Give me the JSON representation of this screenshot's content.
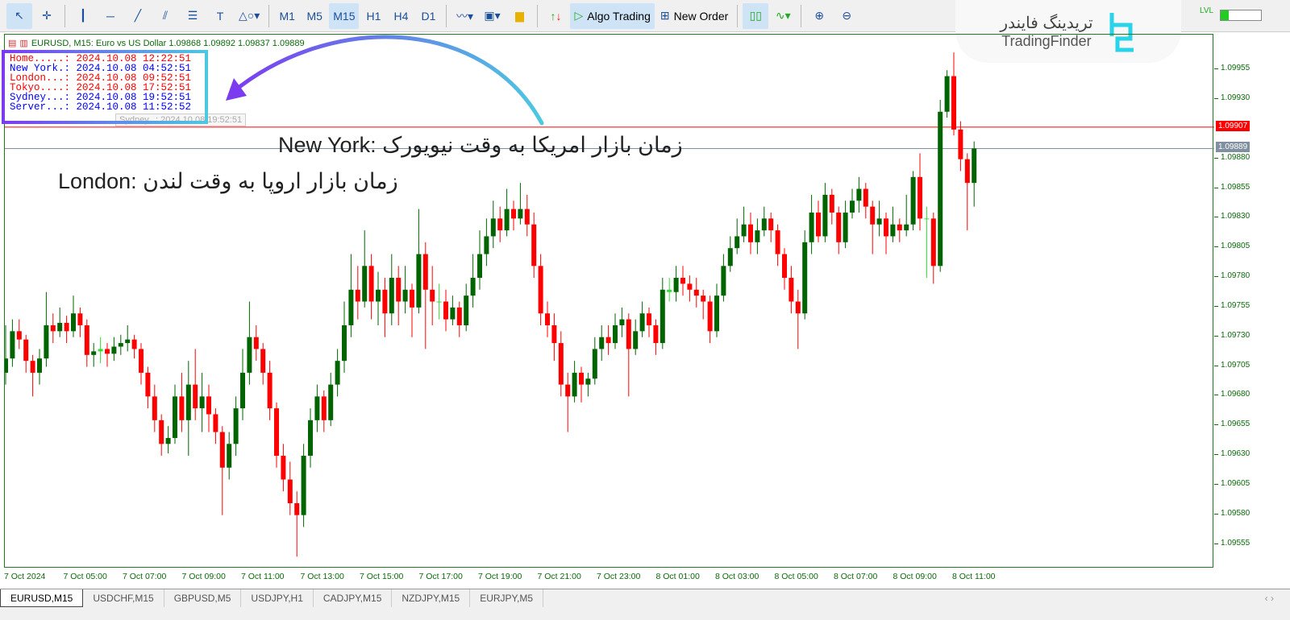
{
  "toolbar": {
    "timeframes": [
      "M1",
      "M5",
      "M15",
      "H1",
      "H4",
      "D1"
    ],
    "active_timeframe": "M15",
    "algo_trading": "Algo Trading",
    "new_order": "New Order"
  },
  "logo": {
    "fa": "تریدینگ فایندر",
    "en": "TradingFinder"
  },
  "chart_header": "EURUSD, M15:  Euro vs US Dollar  1.09868 1.09892 1.09837 1.09889",
  "clock": [
    {
      "label": "Home.....:",
      "value": "2024.10.08 12:22:51",
      "color": "#ff0000"
    },
    {
      "label": "New York.:",
      "value": "2024.10.08 04:52:51",
      "color": "#0000ff"
    },
    {
      "label": "London...:",
      "value": "2024.10.08 09:52:51",
      "color": "#ff0000"
    },
    {
      "label": "Tokyo....:",
      "value": "2024.10.08 17:52:51",
      "color": "#ff0000"
    },
    {
      "label": "Sydney...:",
      "value": "2024.10.08 19:52:51",
      "color": "#0000ff"
    },
    {
      "label": "Server...:",
      "value": "2024.10.08 11:52:52",
      "color": "#0000ff"
    }
  ],
  "tooltip": "Sydney...: 2024.10.08 19:52:51",
  "annotations": {
    "newyork": "New York: زمان بازار امریکا به وقت نیویورک",
    "london": "London: زمان بازار اروپا به وقت لندن"
  },
  "tabs": [
    "EURUSD,M15",
    "USDCHF,M15",
    "GBPUSD,M5",
    "USDJPY,H1",
    "CADJPY,M15",
    "NZDJPY,M15",
    "EURJPY,M5"
  ],
  "active_tab": "EURUSD,M15",
  "chart_data": {
    "type": "candlestick",
    "symbol": "EURUSD",
    "timeframe": "M15",
    "ylim": [
      1.09535,
      1.09985
    ],
    "price_ticks": [
      "1.09955",
      "1.09930",
      "1.09880",
      "1.09855",
      "1.09830",
      "1.09805",
      "1.09780",
      "1.09755",
      "1.09730",
      "1.09705",
      "1.09680",
      "1.09655",
      "1.09630",
      "1.09605",
      "1.09580",
      "1.09555"
    ],
    "time_ticks": [
      "7 Oct 2024",
      "7 Oct 05:00",
      "7 Oct 07:00",
      "7 Oct 09:00",
      "7 Oct 11:00",
      "7 Oct 13:00",
      "7 Oct 15:00",
      "7 Oct 17:00",
      "7 Oct 19:00",
      "7 Oct 21:00",
      "7 Oct 23:00",
      "8 Oct 01:00",
      "8 Oct 03:00",
      "8 Oct 05:00",
      "8 Oct 07:00",
      "8 Oct 09:00",
      "8 Oct 11:00"
    ],
    "lines": [
      {
        "price": "1.09907",
        "color": "#ff0000"
      },
      {
        "price": "1.09889",
        "color": "#8090a0"
      }
    ],
    "colors": {
      "bull": "#006400",
      "bear": "#ff0000",
      "doji": "#33dd33"
    },
    "ohlc": [
      [
        1.097,
        1.0974,
        1.0969,
        1.09712
      ],
      [
        1.09712,
        1.09745,
        1.09705,
        1.09735
      ],
      [
        1.09735,
        1.09745,
        1.0972,
        1.09728
      ],
      [
        1.09728,
        1.09732,
        1.097,
        1.0971
      ],
      [
        1.0971,
        1.09715,
        1.0968,
        1.097
      ],
      [
        1.097,
        1.0972,
        1.0969,
        1.09712
      ],
      [
        1.09712,
        1.09768,
        1.09705,
        1.0974
      ],
      [
        1.0974,
        1.0975,
        1.09725,
        1.09735
      ],
      [
        1.09735,
        1.09755,
        1.0973,
        1.09742
      ],
      [
        1.09742,
        1.09748,
        1.09725,
        1.09735
      ],
      [
        1.09735,
        1.09765,
        1.0973,
        1.0975
      ],
      [
        1.0975,
        1.09755,
        1.0973,
        1.0974
      ],
      [
        1.0974,
        1.09745,
        1.09705,
        1.09715
      ],
      [
        1.09715,
        1.09725,
        1.09705,
        1.09718
      ],
      [
        1.09718,
        1.0973,
        1.09708,
        1.0972
      ],
      [
        1.0972,
        1.09725,
        1.09705,
        1.09716
      ],
      [
        1.09716,
        1.0973,
        1.0971,
        1.09722
      ],
      [
        1.09722,
        1.09732,
        1.09715,
        1.09725
      ],
      [
        1.09725,
        1.0974,
        1.09718,
        1.09728
      ],
      [
        1.09728,
        1.09732,
        1.09712,
        1.0972
      ],
      [
        1.0972,
        1.09725,
        1.0969,
        1.097
      ],
      [
        1.097,
        1.09705,
        1.0967,
        1.0968
      ],
      [
        1.0968,
        1.0969,
        1.0965,
        1.0966
      ],
      [
        1.0966,
        1.09665,
        1.0963,
        1.0964
      ],
      [
        1.0964,
        1.09655,
        1.09632,
        1.09645
      ],
      [
        1.09645,
        1.0969,
        1.0964,
        1.0968
      ],
      [
        1.0968,
        1.097,
        1.0965,
        1.0966
      ],
      [
        1.0966,
        1.0971,
        1.0963,
        1.0969
      ],
      [
        1.0969,
        1.0972,
        1.0966,
        1.0967
      ],
      [
        1.0967,
        1.097,
        1.0965,
        1.0968
      ],
      [
        1.0968,
        1.0969,
        1.0965,
        1.09665
      ],
      [
        1.09665,
        1.0967,
        1.0964,
        1.0965
      ],
      [
        1.0965,
        1.09655,
        1.0958,
        1.0962
      ],
      [
        1.0962,
        1.0965,
        1.0961,
        1.0964
      ],
      [
        1.0964,
        1.0968,
        1.0963,
        1.0967
      ],
      [
        1.0967,
        1.0972,
        1.0966,
        1.097
      ],
      [
        1.097,
        1.0976,
        1.0969,
        1.0973
      ],
      [
        1.0973,
        1.0974,
        1.0971,
        1.0972
      ],
      [
        1.0972,
        1.09725,
        1.0969,
        1.097
      ],
      [
        1.097,
        1.0971,
        1.0966,
        1.0967
      ],
      [
        1.0967,
        1.09675,
        1.0962,
        1.0963
      ],
      [
        1.0963,
        1.0964,
        1.096,
        1.0961
      ],
      [
        1.0961,
        1.09625,
        1.0958,
        1.0959
      ],
      [
        1.0959,
        1.096,
        1.09545,
        1.0958
      ],
      [
        1.0958,
        1.0964,
        1.0957,
        1.0963
      ],
      [
        1.0963,
        1.0967,
        1.0962,
        1.0966
      ],
      [
        1.0966,
        1.0969,
        1.0965,
        1.0968
      ],
      [
        1.0968,
        1.09685,
        1.0965,
        1.0966
      ],
      [
        1.0966,
        1.097,
        1.09655,
        1.0969
      ],
      [
        1.0969,
        1.0972,
        1.0968,
        1.0971
      ],
      [
        1.0971,
        1.0976,
        1.097,
        1.0974
      ],
      [
        1.0974,
        1.098,
        1.0973,
        1.0977
      ],
      [
        1.0977,
        1.0979,
        1.09745,
        1.0976
      ],
      [
        1.0976,
        1.0982,
        1.09755,
        1.0979
      ],
      [
        1.0979,
        1.098,
        1.09745,
        1.0976
      ],
      [
        1.0976,
        1.09785,
        1.0974,
        1.0977
      ],
      [
        1.0977,
        1.0978,
        1.0973,
        1.0975
      ],
      [
        1.0975,
        1.098,
        1.0974,
        1.0978
      ],
      [
        1.0978,
        1.0979,
        1.0974,
        1.0976
      ],
      [
        1.0976,
        1.0979,
        1.0975,
        1.0977
      ],
      [
        1.0977,
        1.09775,
        1.0973,
        1.09755
      ],
      [
        1.09755,
        1.09838,
        1.0975,
        1.098
      ],
      [
        1.098,
        1.0981,
        1.0972,
        1.0977
      ],
      [
        1.0977,
        1.0979,
        1.0974,
        1.0976
      ],
      [
        1.0976,
        1.09775,
        1.09745,
        1.0976
      ],
      [
        1.0976,
        1.0977,
        1.09735,
        1.09745
      ],
      [
        1.09745,
        1.09765,
        1.0974,
        1.09755
      ],
      [
        1.09755,
        1.0976,
        1.0973,
        1.0974
      ],
      [
        1.0974,
        1.09775,
        1.09735,
        1.09765
      ],
      [
        1.09765,
        1.098,
        1.09755,
        1.0978
      ],
      [
        1.0978,
        1.0982,
        1.0977,
        1.098
      ],
      [
        1.098,
        1.0983,
        1.0979,
        1.09815
      ],
      [
        1.09815,
        1.09845,
        1.09805,
        1.0983
      ],
      [
        1.0983,
        1.0984,
        1.0981,
        1.0982
      ],
      [
        1.0982,
        1.09855,
        1.09815,
        1.09838
      ],
      [
        1.09838,
        1.09845,
        1.0982,
        1.0983
      ],
      [
        1.0983,
        1.0986,
        1.09825,
        1.09838
      ],
      [
        1.09838,
        1.0985,
        1.09815,
        1.09825
      ],
      [
        1.09825,
        1.09835,
        1.0978,
        1.0979
      ],
      [
        1.0979,
        1.098,
        1.0974,
        1.0975
      ],
      [
        1.0975,
        1.0976,
        1.0973,
        1.0974
      ],
      [
        1.0974,
        1.0975,
        1.0971,
        1.09725
      ],
      [
        1.09725,
        1.09735,
        1.0968,
        1.0969
      ],
      [
        1.0969,
        1.097,
        1.0965,
        1.0968
      ],
      [
        1.0968,
        1.0971,
        1.09675,
        1.097
      ],
      [
        1.097,
        1.09705,
        1.09675,
        1.0969
      ],
      [
        1.0969,
        1.097,
        1.0968,
        1.09695
      ],
      [
        1.09695,
        1.0973,
        1.0969,
        1.0972
      ],
      [
        1.0972,
        1.0974,
        1.0971,
        1.0973
      ],
      [
        1.0973,
        1.0974,
        1.09715,
        1.09725
      ],
      [
        1.09725,
        1.0975,
        1.0972,
        1.0974
      ],
      [
        1.0974,
        1.09755,
        1.0973,
        1.09745
      ],
      [
        1.09745,
        1.0975,
        1.0968,
        1.0972
      ],
      [
        1.0972,
        1.09745,
        1.09715,
        1.09735
      ],
      [
        1.09735,
        1.0976,
        1.0973,
        1.0975
      ],
      [
        1.0975,
        1.09755,
        1.0973,
        1.0974
      ],
      [
        1.0974,
        1.09745,
        1.09715,
        1.09725
      ],
      [
        1.09725,
        1.0978,
        1.0972,
        1.0977
      ],
      [
        1.0977,
        1.0978,
        1.0976,
        1.09768
      ],
      [
        1.09768,
        1.0979,
        1.0976,
        1.0978
      ],
      [
        1.0978,
        1.0979,
        1.09765,
        1.09775
      ],
      [
        1.09775,
        1.09782,
        1.0976,
        1.0977
      ],
      [
        1.0977,
        1.0978,
        1.09755,
        1.09765
      ],
      [
        1.09765,
        1.0977,
        1.09745,
        1.0976
      ],
      [
        1.0976,
        1.09765,
        1.09725,
        1.09735
      ],
      [
        1.09735,
        1.09775,
        1.0973,
        1.09765
      ],
      [
        1.09765,
        1.098,
        1.0976,
        1.0979
      ],
      [
        1.0979,
        1.09815,
        1.09785,
        1.09805
      ],
      [
        1.09805,
        1.0983,
        1.098,
        1.09815
      ],
      [
        1.09815,
        1.0984,
        1.0981,
        1.09825
      ],
      [
        1.09825,
        1.09835,
        1.098,
        1.0981
      ],
      [
        1.0981,
        1.0983,
        1.098,
        1.0982
      ],
      [
        1.0982,
        1.0984,
        1.09815,
        1.0983
      ],
      [
        1.0983,
        1.09835,
        1.0981,
        1.0982
      ],
      [
        1.0982,
        1.09825,
        1.0979,
        1.098
      ],
      [
        1.098,
        1.09805,
        1.0977,
        1.0978
      ],
      [
        1.0978,
        1.0979,
        1.0975,
        1.0976
      ],
      [
        1.0976,
        1.0977,
        1.0972,
        1.0975
      ],
      [
        1.0975,
        1.0982,
        1.09745,
        1.0981
      ],
      [
        1.0981,
        1.0985,
        1.098,
        1.09835
      ],
      [
        1.09835,
        1.09845,
        1.0981,
        1.09815
      ],
      [
        1.09815,
        1.0986,
        1.0981,
        1.0985
      ],
      [
        1.0985,
        1.09855,
        1.09825,
        1.09835
      ],
      [
        1.09835,
        1.0984,
        1.098,
        1.0981
      ],
      [
        1.0981,
        1.09845,
        1.09805,
        1.09835
      ],
      [
        1.09835,
        1.09855,
        1.0983,
        1.09845
      ],
      [
        1.09845,
        1.09865,
        1.09835,
        1.09855
      ],
      [
        1.09855,
        1.0986,
        1.0983,
        1.0984
      ],
      [
        1.0984,
        1.09845,
        1.098,
        1.09825
      ],
      [
        1.09825,
        1.09845,
        1.09815,
        1.0983
      ],
      [
        1.0983,
        1.09835,
        1.098,
        1.09815
      ],
      [
        1.09815,
        1.0984,
        1.0981,
        1.09825
      ],
      [
        1.09825,
        1.0983,
        1.0981,
        1.0982
      ],
      [
        1.0982,
        1.0985,
        1.09815,
        1.09825
      ],
      [
        1.09825,
        1.0987,
        1.0982,
        1.09865
      ],
      [
        1.09865,
        1.09885,
        1.0982,
        1.0983
      ],
      [
        1.0983,
        1.0984,
        1.0978,
        1.0983
      ],
      [
        1.0983,
        1.09835,
        1.09775,
        1.0979
      ],
      [
        1.0979,
        1.0993,
        1.09785,
        1.0992
      ],
      [
        1.0992,
        1.09955,
        1.09915,
        1.0995
      ],
      [
        1.0995,
        1.0997,
        1.099,
        1.09905
      ],
      [
        1.09905,
        1.09912,
        1.0987,
        1.0988
      ],
      [
        1.0988,
        1.09885,
        1.0982,
        1.0986
      ],
      [
        1.0986,
        1.09895,
        1.0984,
        1.09889
      ]
    ]
  }
}
